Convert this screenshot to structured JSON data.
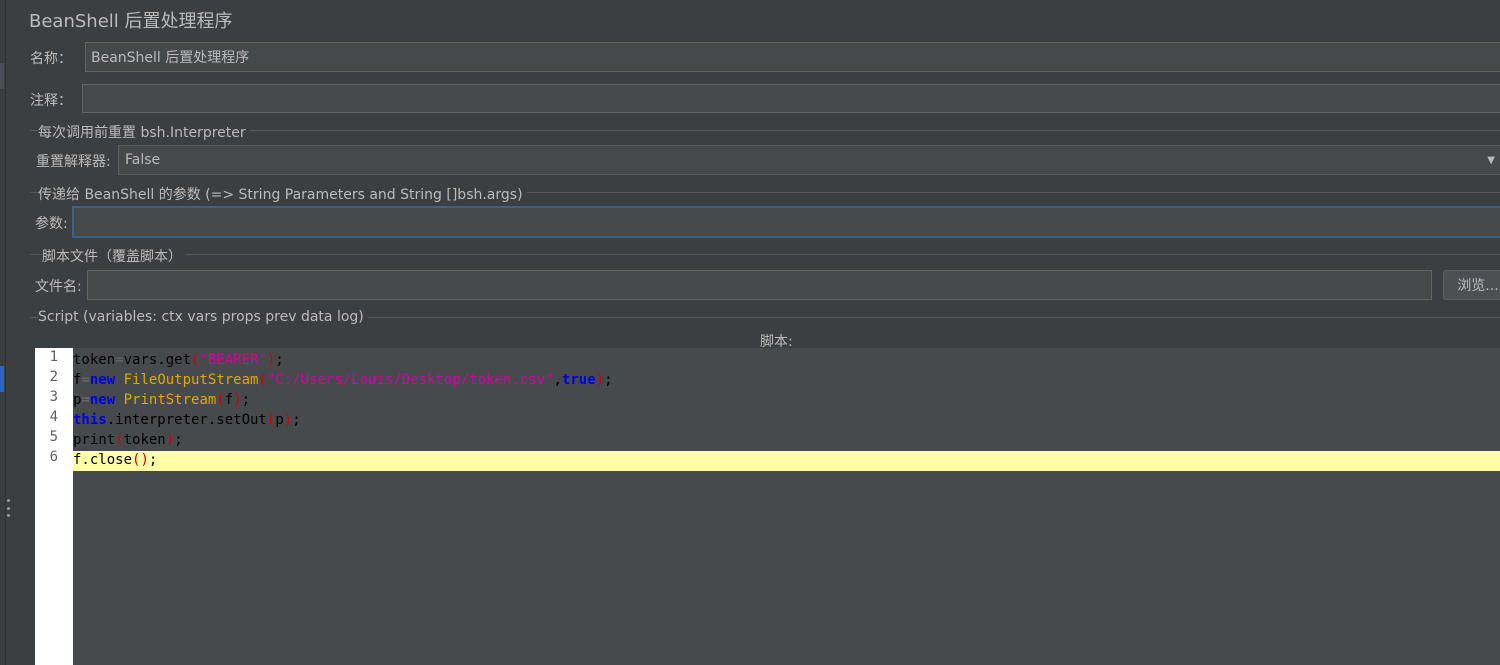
{
  "panel": {
    "title": "BeanShell 后置处理程序"
  },
  "name_field": {
    "label": "名称：",
    "value": "BeanShell 后置处理程序"
  },
  "comment_field": {
    "label": "注释：",
    "value": ""
  },
  "reset_section": {
    "title": "每次调用前重置 bsh.Interpreter",
    "label": "重置解释器:",
    "value": "False"
  },
  "params_section": {
    "title": "传递给 BeanShell 的参数 (=> String Parameters and String []bsh.args)",
    "label": "参数:",
    "value": ""
  },
  "file_section": {
    "title": "脚本文件（覆盖脚本）",
    "label": "文件名:",
    "value": "",
    "browse_label": "浏览..."
  },
  "script_section": {
    "title": "Script (variables: ctx vars props prev data log)",
    "editor_label": "脚本:"
  },
  "script": {
    "line_numbers": [
      "1",
      "2",
      "3",
      "4",
      "5",
      "6"
    ],
    "lines": [
      [
        {
          "t": "token",
          "c": ""
        },
        {
          "t": "=",
          "c": "dim"
        },
        {
          "t": "vars.get",
          "c": ""
        },
        {
          "t": "(",
          "c": "par"
        },
        {
          "t": "\"BEARER\"",
          "c": "str"
        },
        {
          "t": ")",
          "c": "par"
        },
        {
          "t": ";",
          "c": ""
        }
      ],
      [
        {
          "t": "f",
          "c": ""
        },
        {
          "t": "=",
          "c": "dim"
        },
        {
          "t": "new",
          "c": "kw"
        },
        {
          "t": " ",
          "c": ""
        },
        {
          "t": "FileOutputStream",
          "c": "ty"
        },
        {
          "t": "(",
          "c": "par"
        },
        {
          "t": "\"C:/Users/Louis/Desktop/token.csv\"",
          "c": "str"
        },
        {
          "t": ",",
          "c": ""
        },
        {
          "t": "true",
          "c": "kw"
        },
        {
          "t": ")",
          "c": "par"
        },
        {
          "t": ";",
          "c": ""
        }
      ],
      [
        {
          "t": "p",
          "c": ""
        },
        {
          "t": "=",
          "c": "dim"
        },
        {
          "t": "new",
          "c": "kw"
        },
        {
          "t": " ",
          "c": ""
        },
        {
          "t": "PrintStream",
          "c": "ty"
        },
        {
          "t": "(",
          "c": "par"
        },
        {
          "t": "f",
          "c": ""
        },
        {
          "t": ")",
          "c": "par"
        },
        {
          "t": ";",
          "c": ""
        }
      ],
      [
        {
          "t": "this",
          "c": "kw"
        },
        {
          "t": ".interpreter.setOut",
          "c": ""
        },
        {
          "t": "(",
          "c": "par"
        },
        {
          "t": "p",
          "c": ""
        },
        {
          "t": ")",
          "c": "par"
        },
        {
          "t": ";",
          "c": ""
        }
      ],
      [
        {
          "t": "print",
          "c": ""
        },
        {
          "t": "(",
          "c": "par"
        },
        {
          "t": "token",
          "c": ""
        },
        {
          "t": ")",
          "c": "par"
        },
        {
          "t": ";",
          "c": ""
        }
      ],
      [
        {
          "t": "f.close",
          "c": ""
        },
        {
          "t": "()",
          "c": "par"
        },
        {
          "t": ";",
          "c": ""
        }
      ]
    ],
    "highlighted_line": 6
  },
  "colors": {
    "background": "#3c3f41",
    "field": "#45494a",
    "highlight": "#ffffa8",
    "keyword": "#0000e6",
    "type": "#e0a700",
    "string": "#d400a8"
  },
  "icons": {
    "dropdown": "chevron-down-icon",
    "splitter": "drag-handle-icon"
  }
}
